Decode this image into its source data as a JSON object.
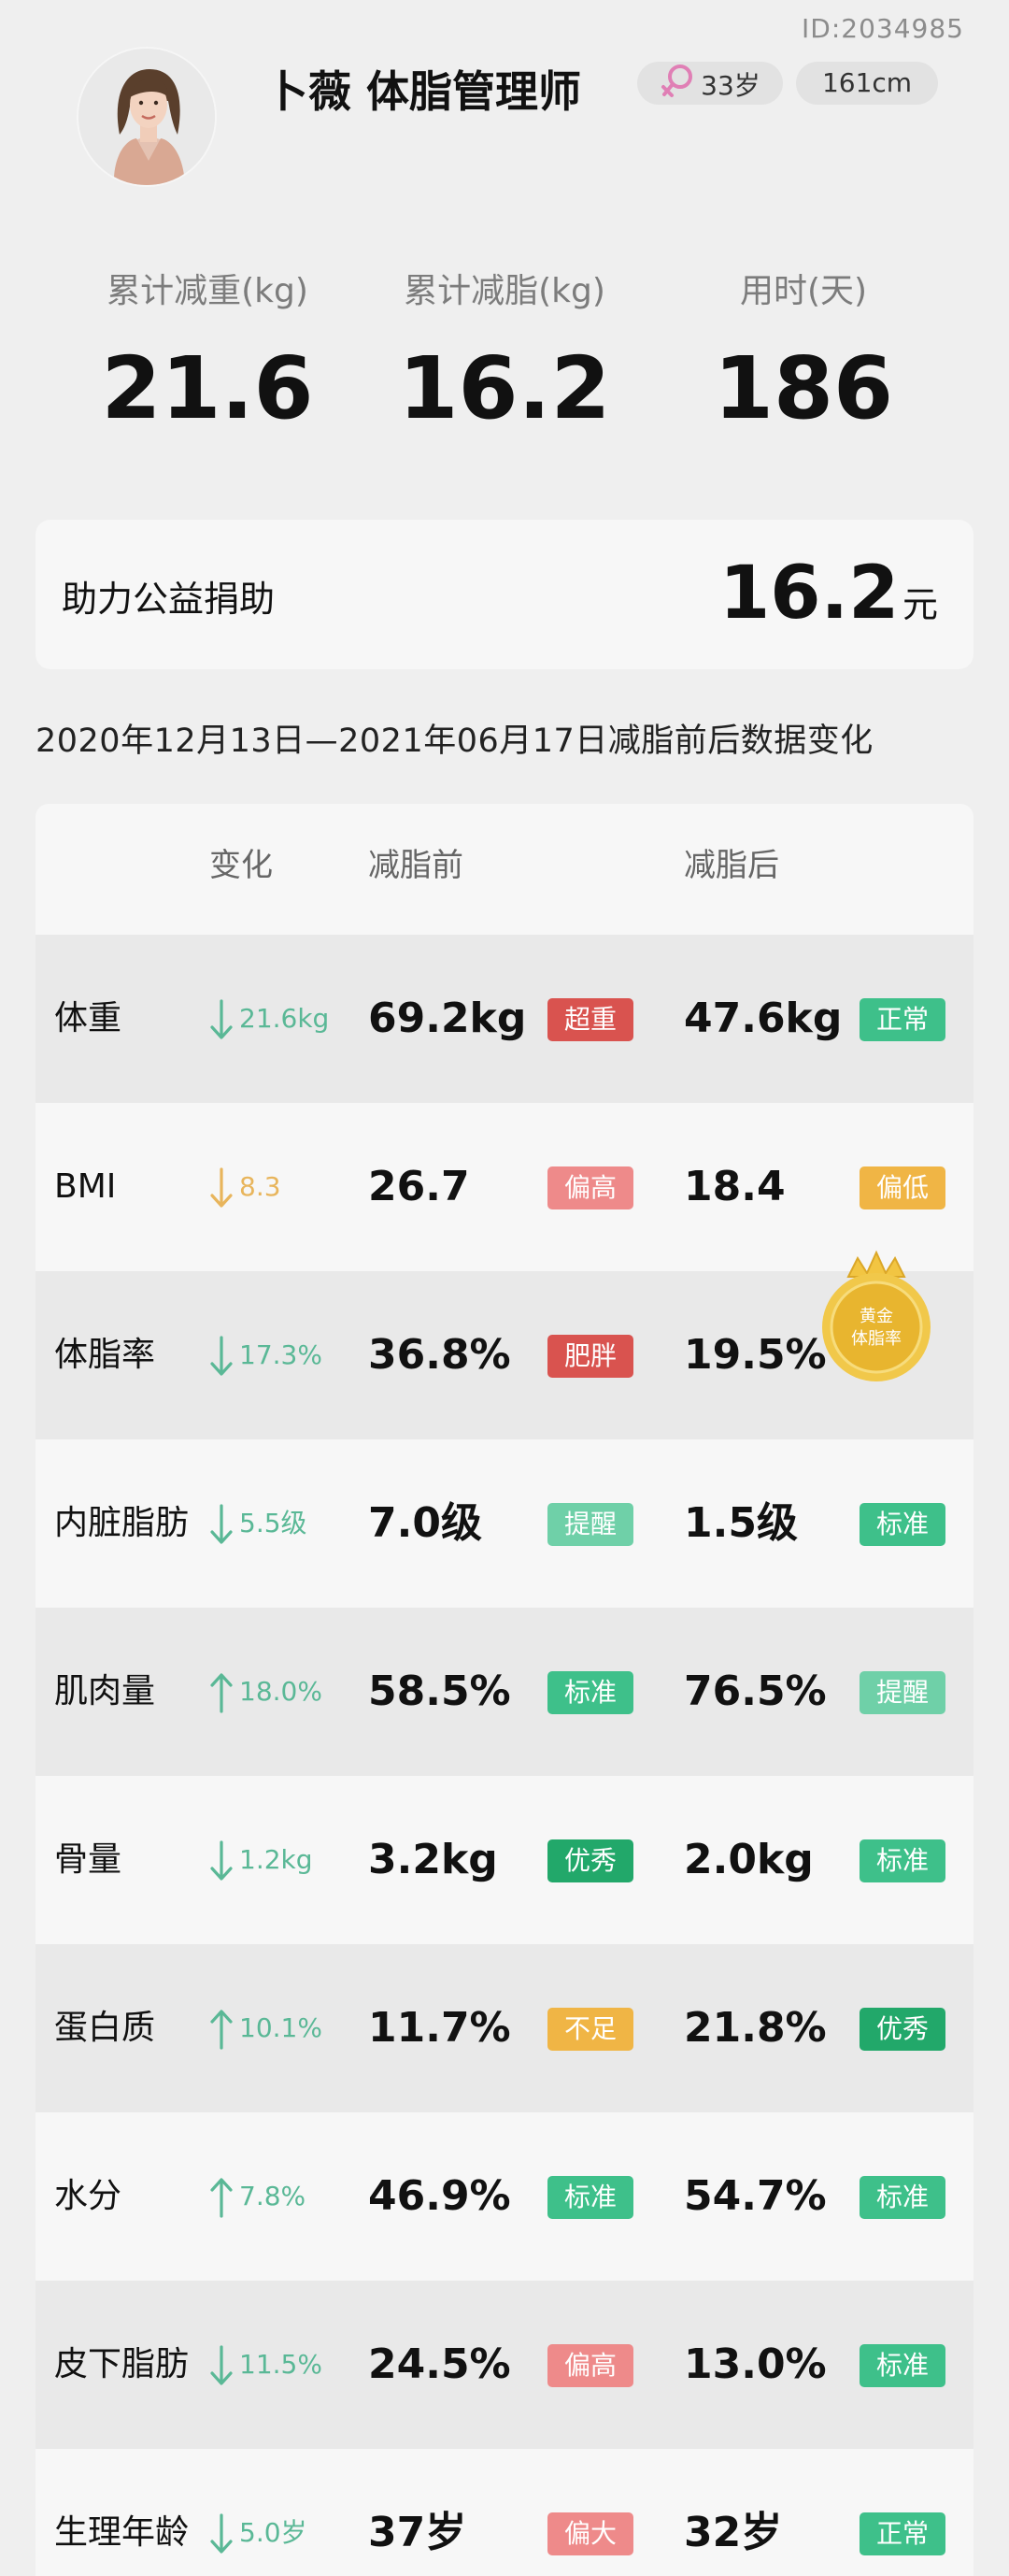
{
  "header": {
    "user_id": "ID:2034985",
    "name": "卜薇 体脂管理师",
    "age": "33岁",
    "height": "161cm"
  },
  "stats": [
    {
      "label": "累计减重(kg)",
      "value": "21.6"
    },
    {
      "label": "累计减脂(kg)",
      "value": "16.2"
    },
    {
      "label": "用时(天)",
      "value": "186"
    }
  ],
  "donation": {
    "label": "助力公益捐助",
    "amount": "16.2",
    "unit": "元"
  },
  "period_title": "2020年12月13日—2021年06月17日减脂前后数据变化",
  "table": {
    "headers": {
      "change": "变化",
      "before": "减脂前",
      "after": "减脂后"
    },
    "rows": [
      {
        "label": "体重",
        "direction": "down",
        "change": "21.6kg",
        "change_color": "#5ab896",
        "before": "69.2kg",
        "before_badge": "超重",
        "before_badge_color": "#d9534f",
        "after": "47.6kg",
        "after_badge": "正常",
        "after_badge_color": "#3ec08a"
      },
      {
        "label": "BMI",
        "direction": "down",
        "change": "8.3",
        "change_color": "#e8b55c",
        "before": "26.7",
        "before_badge": "偏高",
        "before_badge_color": "#ee8a8a",
        "after": "18.4",
        "after_badge": "偏低",
        "after_badge_color": "#f0b545"
      },
      {
        "label": "体脂率",
        "direction": "down",
        "change": "17.3%",
        "change_color": "#5ab896",
        "before": "36.8%",
        "before_badge": "肥胖",
        "before_badge_color": "#d9534f",
        "after": "19.5%",
        "after_badge": "",
        "after_badge_color": "",
        "medal": "黄金体脂率"
      },
      {
        "label": "内脏脂肪",
        "direction": "down",
        "change": "5.5级",
        "change_color": "#5ab896",
        "before": "7.0级",
        "before_badge": "提醒",
        "before_badge_color": "#6fd0a8",
        "after": "1.5级",
        "after_badge": "标准",
        "after_badge_color": "#3ec08a"
      },
      {
        "label": "肌肉量",
        "direction": "up",
        "change": "18.0%",
        "change_color": "#5ab896",
        "before": "58.5%",
        "before_badge": "标准",
        "before_badge_color": "#3ec08a",
        "after": "76.5%",
        "after_badge": "提醒",
        "after_badge_color": "#6fd0a8"
      },
      {
        "label": "骨量",
        "direction": "down",
        "change": "1.2kg",
        "change_color": "#5ab896",
        "before": "3.2kg",
        "before_badge": "优秀",
        "before_badge_color": "#22a86a",
        "after": "2.0kg",
        "after_badge": "标准",
        "after_badge_color": "#3ec08a"
      },
      {
        "label": "蛋白质",
        "direction": "up",
        "change": "10.1%",
        "change_color": "#5ab896",
        "before": "11.7%",
        "before_badge": "不足",
        "before_badge_color": "#f0b545",
        "after": "21.8%",
        "after_badge": "优秀",
        "after_badge_color": "#22a86a"
      },
      {
        "label": "水分",
        "direction": "up",
        "change": "7.8%",
        "change_color": "#5ab896",
        "before": "46.9%",
        "before_badge": "标准",
        "before_badge_color": "#3ec08a",
        "after": "54.7%",
        "after_badge": "标准",
        "after_badge_color": "#3ec08a"
      },
      {
        "label": "皮下脂肪",
        "direction": "down",
        "change": "11.5%",
        "change_color": "#5ab896",
        "before": "24.5%",
        "before_badge": "偏高",
        "before_badge_color": "#ee8a8a",
        "after": "13.0%",
        "after_badge": "标准",
        "after_badge_color": "#3ec08a"
      },
      {
        "label": "生理年龄",
        "direction": "down",
        "change": "5.0岁",
        "change_color": "#5ab896",
        "before": "37岁",
        "before_badge": "偏大",
        "before_badge_color": "#ee8a8a",
        "after": "32岁",
        "after_badge": "正常",
        "after_badge_color": "#3ec08a"
      }
    ]
  },
  "icons": {
    "avatar": "person-photo",
    "gender": "female-symbol-icon",
    "arrows": [
      "arrow-up-icon",
      "arrow-down-icon"
    ],
    "medal": "gold-medal-icon"
  }
}
